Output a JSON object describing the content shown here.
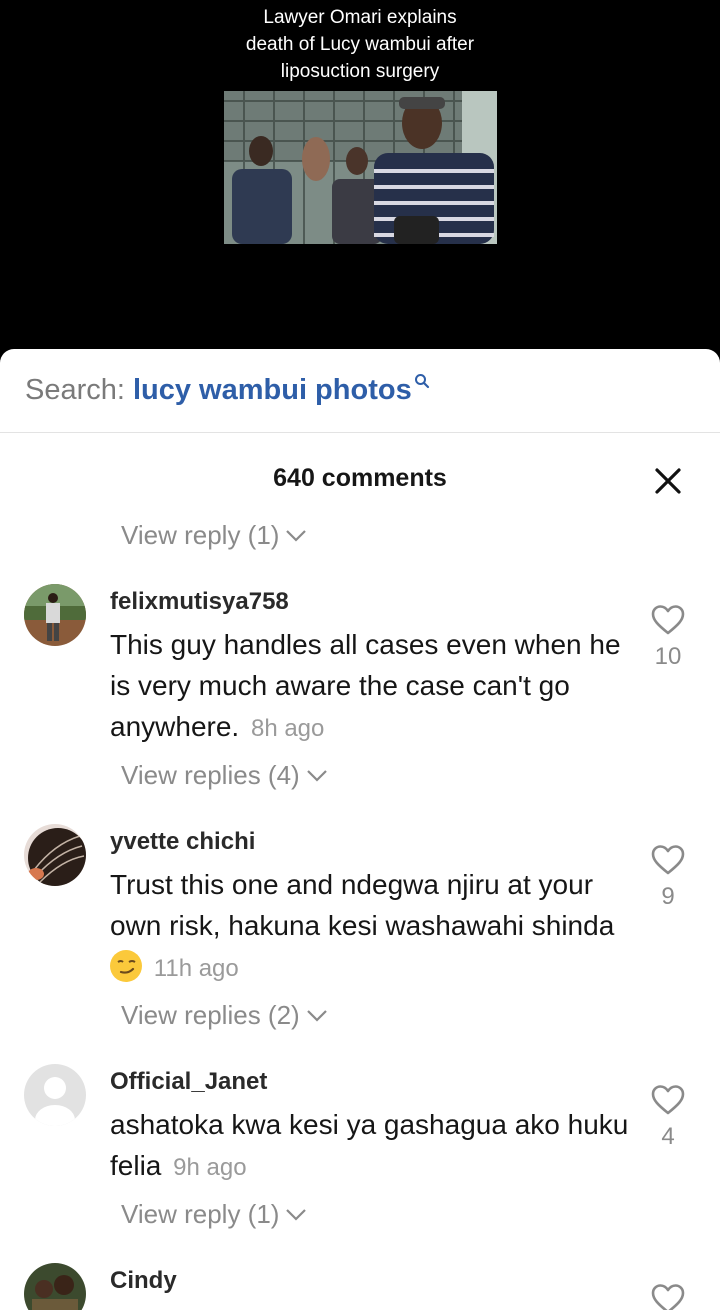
{
  "video": {
    "caption_lines": [
      "Lawyer Omari explains",
      "death of  Lucy wambui after",
      "liposuction surgery"
    ]
  },
  "search": {
    "prefix": "Search:",
    "query": "lucy wambui photos"
  },
  "comments_header": {
    "count_label": "640 comments"
  },
  "top_view_link": "View reply (1)",
  "comments": [
    {
      "username": "felixmutisya758",
      "text": "This guy handles all cases even when he is very much aware the case can't go anywhere.",
      "time": "8h ago",
      "likes": "10",
      "replies_label": "View replies (4)"
    },
    {
      "username": "yvette chichi",
      "text": "Trust this one and ndegwa njiru at your own risk, hakuna kesi washawahi shinda",
      "time": "11h ago",
      "likes": "9",
      "replies_label": "View replies (2)"
    },
    {
      "username": "Official_Janet",
      "text": "ashatoka kwa kesi ya gashagua ako huku felia",
      "time": "9h ago",
      "likes": "4",
      "replies_label": "View reply (1)"
    },
    {
      "username": "Cindy"
    }
  ],
  "colors": {
    "search_query": "#2e5ea8",
    "muted_text": "#8a8a8a",
    "emoji": "#fbc93b"
  }
}
